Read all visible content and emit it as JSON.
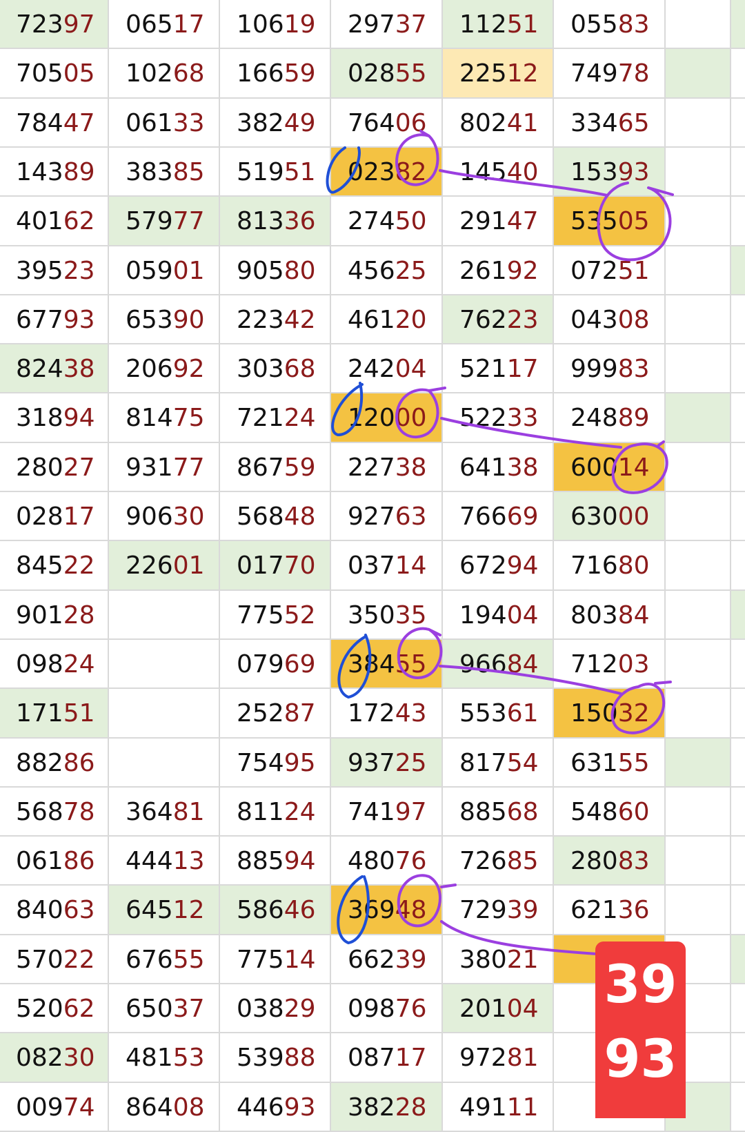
{
  "sheet": {
    "rows": [
      [
        "72397",
        "06517",
        "10619",
        "29737",
        "11251",
        "05583",
        "",
        ""
      ],
      [
        "70505",
        "10268",
        "16659",
        "02855",
        "22512",
        "74978",
        "",
        ""
      ],
      [
        "78447",
        "06133",
        "38249",
        "76406",
        "80241",
        "33465",
        "",
        ""
      ],
      [
        "14389",
        "38385",
        "51951",
        "02382",
        "14540",
        "15393",
        "",
        ""
      ],
      [
        "40162",
        "57977",
        "81336",
        "27450",
        "29147",
        "53505",
        "",
        ""
      ],
      [
        "39523",
        "05901",
        "90580",
        "45625",
        "26192",
        "07251",
        "",
        ""
      ],
      [
        "67793",
        "65390",
        "22342",
        "46120",
        "76223",
        "04308",
        "",
        ""
      ],
      [
        "82438",
        "20692",
        "30368",
        "24204",
        "52117",
        "99983",
        "",
        ""
      ],
      [
        "31894",
        "81475",
        "72124",
        "12000",
        "52233",
        "24889",
        "",
        ""
      ],
      [
        "28027",
        "93177",
        "86759",
        "22738",
        "64138",
        "60014",
        "",
        ""
      ],
      [
        "02817",
        "90630",
        "56848",
        "92763",
        "76669",
        "63000",
        "",
        ""
      ],
      [
        "84522",
        "22601",
        "01770",
        "03714",
        "67294",
        "71680",
        "",
        ""
      ],
      [
        "90128",
        "",
        "77552",
        "35035",
        "19404",
        "80384",
        "",
        ""
      ],
      [
        "09824",
        "",
        "07969",
        "38455",
        "96684",
        "71203",
        "",
        ""
      ],
      [
        "17151",
        "",
        "25287",
        "17243",
        "55361",
        "15032",
        "",
        ""
      ],
      [
        "88286",
        "",
        "75495",
        "93725",
        "81754",
        "63155",
        "",
        ""
      ],
      [
        "56878",
        "36481",
        "81124",
        "74197",
        "88568",
        "54860",
        "",
        ""
      ],
      [
        "06186",
        "44413",
        "88594",
        "48076",
        "72685",
        "28083",
        "",
        ""
      ],
      [
        "84063",
        "64512",
        "58646",
        "36948",
        "72939",
        "62136",
        "",
        ""
      ],
      [
        "57022",
        "67655",
        "77514",
        "66239",
        "38021",
        "",
        "",
        ""
      ],
      [
        "52062",
        "65037",
        "03829",
        "09876",
        "20104",
        "",
        "",
        ""
      ],
      [
        "08230",
        "48153",
        "53988",
        "08717",
        "97281",
        "",
        "",
        ""
      ],
      [
        "00974",
        "86408",
        "44693",
        "38228",
        "49111",
        "",
        "",
        ""
      ]
    ],
    "highlights": [
      {
        "row": 0,
        "col": 0,
        "tone": "green"
      },
      {
        "row": 0,
        "col": 4,
        "tone": "green"
      },
      {
        "row": 0,
        "col": 7,
        "tone": "green"
      },
      {
        "row": 1,
        "col": 3,
        "tone": "green"
      },
      {
        "row": 1,
        "col": 4,
        "tone": "yellow"
      },
      {
        "row": 1,
        "col": 6,
        "tone": "green"
      },
      {
        "row": 3,
        "col": 3,
        "tone": "orange"
      },
      {
        "row": 3,
        "col": 5,
        "tone": "green"
      },
      {
        "row": 4,
        "col": 1,
        "tone": "green"
      },
      {
        "row": 4,
        "col": 2,
        "tone": "green"
      },
      {
        "row": 4,
        "col": 5,
        "tone": "orange"
      },
      {
        "row": 5,
        "col": 7,
        "tone": "green"
      },
      {
        "row": 6,
        "col": 4,
        "tone": "green"
      },
      {
        "row": 7,
        "col": 0,
        "tone": "green"
      },
      {
        "row": 8,
        "col": 3,
        "tone": "orange"
      },
      {
        "row": 8,
        "col": 6,
        "tone": "green"
      },
      {
        "row": 9,
        "col": 5,
        "tone": "orange"
      },
      {
        "row": 10,
        "col": 5,
        "tone": "green"
      },
      {
        "row": 11,
        "col": 1,
        "tone": "green"
      },
      {
        "row": 11,
        "col": 2,
        "tone": "green"
      },
      {
        "row": 12,
        "col": 7,
        "tone": "green"
      },
      {
        "row": 13,
        "col": 3,
        "tone": "orange"
      },
      {
        "row": 13,
        "col": 4,
        "tone": "green"
      },
      {
        "row": 14,
        "col": 0,
        "tone": "green"
      },
      {
        "row": 14,
        "col": 5,
        "tone": "orange"
      },
      {
        "row": 15,
        "col": 3,
        "tone": "green"
      },
      {
        "row": 15,
        "col": 6,
        "tone": "green"
      },
      {
        "row": 17,
        "col": 5,
        "tone": "green"
      },
      {
        "row": 18,
        "col": 1,
        "tone": "green"
      },
      {
        "row": 18,
        "col": 2,
        "tone": "green"
      },
      {
        "row": 18,
        "col": 3,
        "tone": "orange"
      },
      {
        "row": 19,
        "col": 5,
        "tone": "orange"
      },
      {
        "row": 19,
        "col": 7,
        "tone": "green"
      },
      {
        "row": 20,
        "col": 4,
        "tone": "green"
      },
      {
        "row": 21,
        "col": 0,
        "tone": "green"
      },
      {
        "row": 22,
        "col": 3,
        "tone": "green"
      },
      {
        "row": 22,
        "col": 6,
        "tone": "green"
      }
    ],
    "colors": {
      "prefix": "#111111",
      "suffix": "#8b1a1a",
      "green": "#e2efda",
      "orange": "#f4c242",
      "yellow": "#fde9b4",
      "gridline": "#d9d9d9",
      "annotation_blue": "#1f4fd6",
      "annotation_purple": "#9b3fe0"
    }
  },
  "badge": {
    "line1": "39",
    "line2": "93",
    "color": "#f03c3c"
  }
}
